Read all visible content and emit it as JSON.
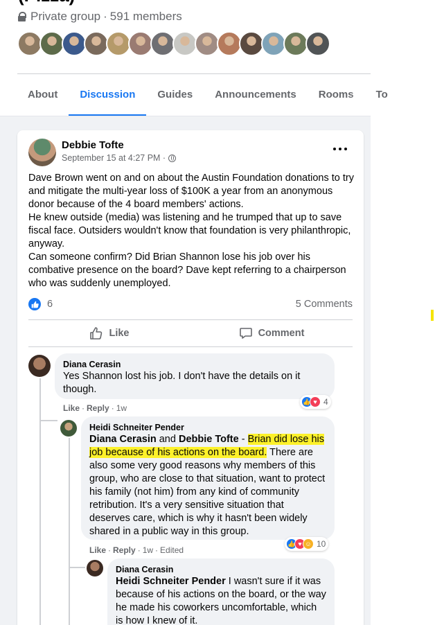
{
  "group": {
    "title": "(Pizza)",
    "privacy": "Private group",
    "member_count": "591 members"
  },
  "member_avatars": [
    {
      "color": "#8d7a63"
    },
    {
      "color": "#5d6b4a"
    },
    {
      "color": "#3c5a8c"
    },
    {
      "color": "#7a6a5c"
    },
    {
      "color": "#b59a6a"
    },
    {
      "color": "#9a7b72"
    },
    {
      "color": "#6f6f73"
    },
    {
      "color": "#c8c8c4"
    },
    {
      "color": "#a08c84"
    },
    {
      "color": "#b57a5c"
    },
    {
      "color": "#5a4a40"
    },
    {
      "color": "#7fa3b8"
    },
    {
      "color": "#6c7a5a"
    },
    {
      "color": "#505456"
    }
  ],
  "tabs": [
    "About",
    "Discussion",
    "Guides",
    "Announcements",
    "Rooms",
    "To"
  ],
  "active_tab": "Discussion",
  "post": {
    "author": "Debbie Tofte",
    "time": "September 15 at 4:27 PM ·",
    "privacy_icon": "globe-icon",
    "text": "Dave Brown went on and on about the Austin Foundation donations to try and mitigate the multi-year loss of $100K a year from an anonymous donor because of the 4 board members' actions.\nHe knew outside (media) was listening and he trumped that up to save fiscal face.  Outsiders wouldn't know that foundation is very philanthropic, anyway.\nCan someone confirm?  Did Brian Shannon lose his job over his combative presence on the board?  Dave kept referring to a chairperson who was suddenly unemployed.",
    "like_count": "6",
    "comment_count": "5 Comments",
    "like_label": "Like",
    "comment_label": "Comment"
  },
  "comments": [
    {
      "author": "Diana Cerasin",
      "text": "Yes Shannon lost his job. I don't have the details on it though.",
      "like": "Like",
      "reply": "Reply",
      "age": "1w",
      "reaction_count": "4"
    },
    {
      "author": "Heidi Schneiter Pender",
      "mention1": "Diana Cerasin",
      "joiner": " and ",
      "mention2": "Debbie Tofte",
      "dash": " - ",
      "highlight_a": "Brian did lose his",
      "highlight_b": "job because of his actions on the board.",
      "rest": " There are also some very good reasons why members of this group, who are close to that situation, want to protect his family (not him) from any kind of community retribution. It's a very sensitive situation that deserves care, which is why it hasn't been widely shared in a public way in this group.",
      "like": "Like",
      "reply": "Reply",
      "age": "1w",
      "edited": "Edited",
      "reaction_count": "10"
    },
    {
      "author": "Diana Cerasin",
      "mention": "Heidi Schneiter Pender",
      "text": " I wasn't sure if it was because of his actions on the board, or the way he made his coworkers uncomfortable, which is how I knew of it."
    }
  ],
  "colors": {
    "accent": "#1877f2",
    "highlight": "#fdf12a",
    "feed_bg": "#f0f2f5"
  }
}
